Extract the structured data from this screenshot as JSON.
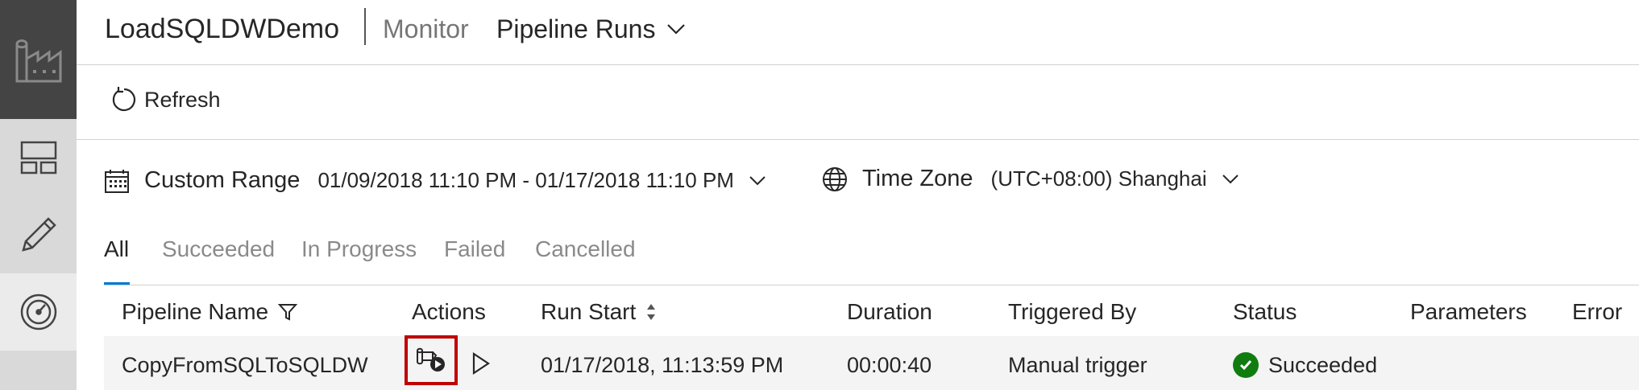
{
  "header": {
    "factory_name": "LoadSQLDWDemo",
    "section": "Monitor",
    "page_title": "Pipeline Runs"
  },
  "sidebar": {
    "items": [
      {
        "icon": "factory-icon"
      },
      {
        "icon": "dashboard-icon"
      },
      {
        "icon": "pencil-icon"
      },
      {
        "icon": "monitor-gauge-icon",
        "active": true
      }
    ]
  },
  "toolbar": {
    "refresh_label": "Refresh"
  },
  "filters": {
    "range_label": "Custom Range",
    "range_value": "01/09/2018 11:10 PM - 01/17/2018 11:10 PM",
    "timezone_label": "Time Zone",
    "timezone_value": "(UTC+08:00) Shanghai"
  },
  "tabs": [
    {
      "label": "All",
      "active": true
    },
    {
      "label": "Succeeded"
    },
    {
      "label": "In Progress"
    },
    {
      "label": "Failed"
    },
    {
      "label": "Cancelled"
    }
  ],
  "table": {
    "columns": [
      "Pipeline Name",
      "Actions",
      "Run Start",
      "Duration",
      "Triggered By",
      "Status",
      "Parameters",
      "Error"
    ],
    "rows": [
      {
        "pipeline_name": "CopyFromSQLToSQLDW",
        "run_start": "01/17/2018, 11:13:59 PM",
        "duration": "00:00:40",
        "triggered_by": "Manual trigger",
        "status": "Succeeded"
      }
    ]
  },
  "colors": {
    "accent": "#0078d4",
    "success": "#107c10",
    "highlight": "#c00000",
    "rail_dark": "#444444"
  }
}
